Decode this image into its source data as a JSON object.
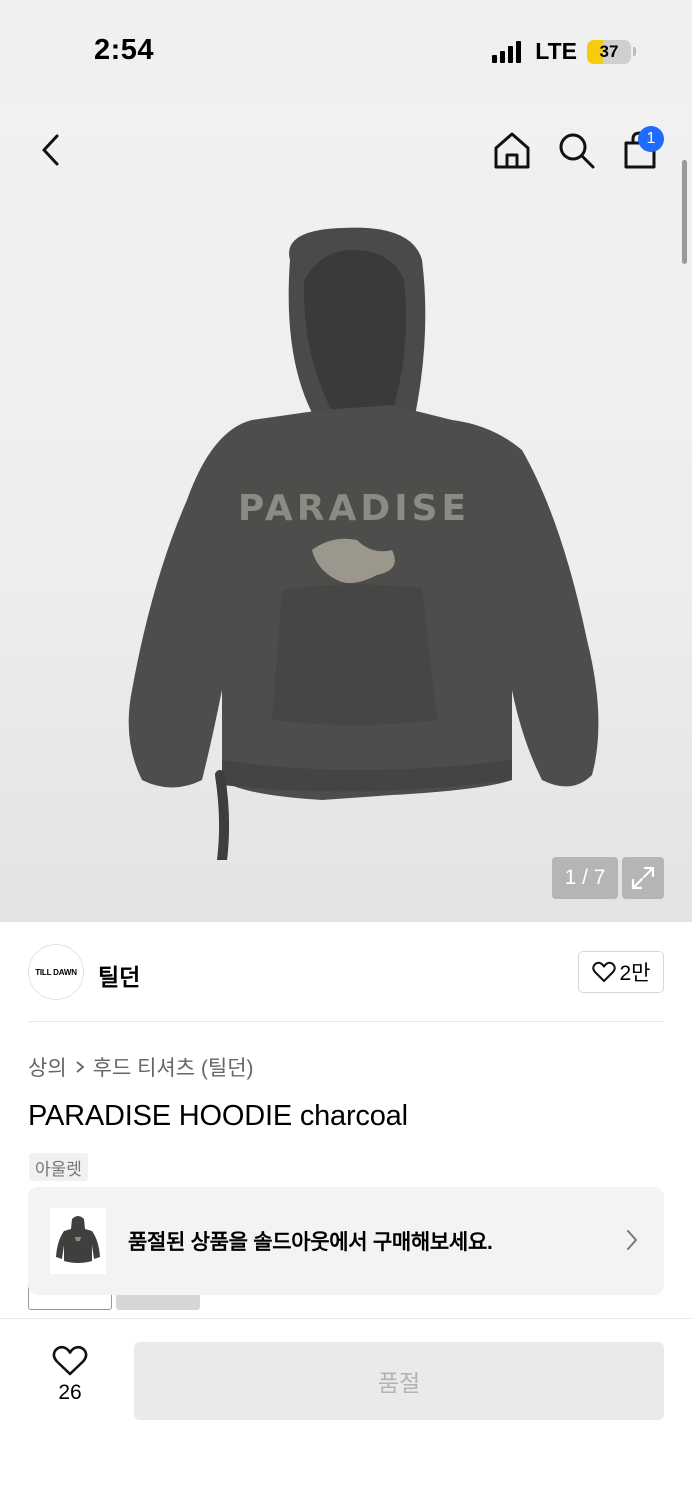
{
  "status_bar": {
    "time": "2:54",
    "network": "LTE",
    "battery": "37",
    "battery_color": "#f6cc0e"
  },
  "header": {
    "icons": [
      "back-icon",
      "home-icon",
      "search-icon",
      "shopping-bag-icon"
    ],
    "cart_badge": "1",
    "badge_color": "#1f6bff"
  },
  "gallery": {
    "counter": "1 / 7",
    "image_print_text": "PARADISE"
  },
  "brand": {
    "logo_text": "TILL DAWN",
    "name": "틸던",
    "like_count": "2만"
  },
  "breadcrumb": {
    "category": "상의",
    "subcategory": "후드 티셔츠 (틸던)"
  },
  "product": {
    "title": "PARADISE HOODIE charcoal",
    "tag": "아울렛"
  },
  "soldout_banner": {
    "text": "품절된 상품을 솔드아웃에서 구매해보세요."
  },
  "bottom_bar": {
    "wish_count": "26",
    "buy_label": "품절"
  }
}
